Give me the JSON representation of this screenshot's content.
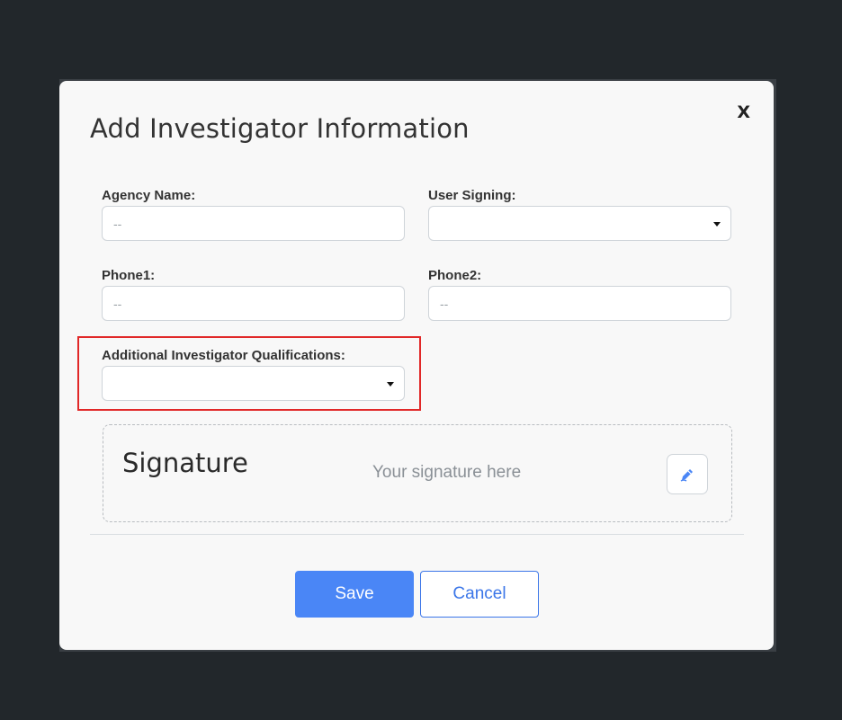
{
  "modal": {
    "title": "Add Investigator Information",
    "close_label": "X"
  },
  "fields": {
    "agency_name": {
      "label": "Agency Name:",
      "placeholder": "--"
    },
    "user_signing": {
      "label": "User Signing:",
      "value": ""
    },
    "phone1": {
      "label": "Phone1:",
      "placeholder": "--"
    },
    "phone2": {
      "label": "Phone2:",
      "placeholder": "--"
    },
    "additional_qualifications": {
      "label": "Additional Investigator Qualifications:",
      "value": ""
    }
  },
  "signature": {
    "title": "Signature",
    "placeholder": "Your signature here",
    "edit_icon": "pen-icon"
  },
  "buttons": {
    "save": "Save",
    "cancel": "Cancel"
  },
  "colors": {
    "primary": "#4a86f6",
    "highlight": "#e12828"
  }
}
